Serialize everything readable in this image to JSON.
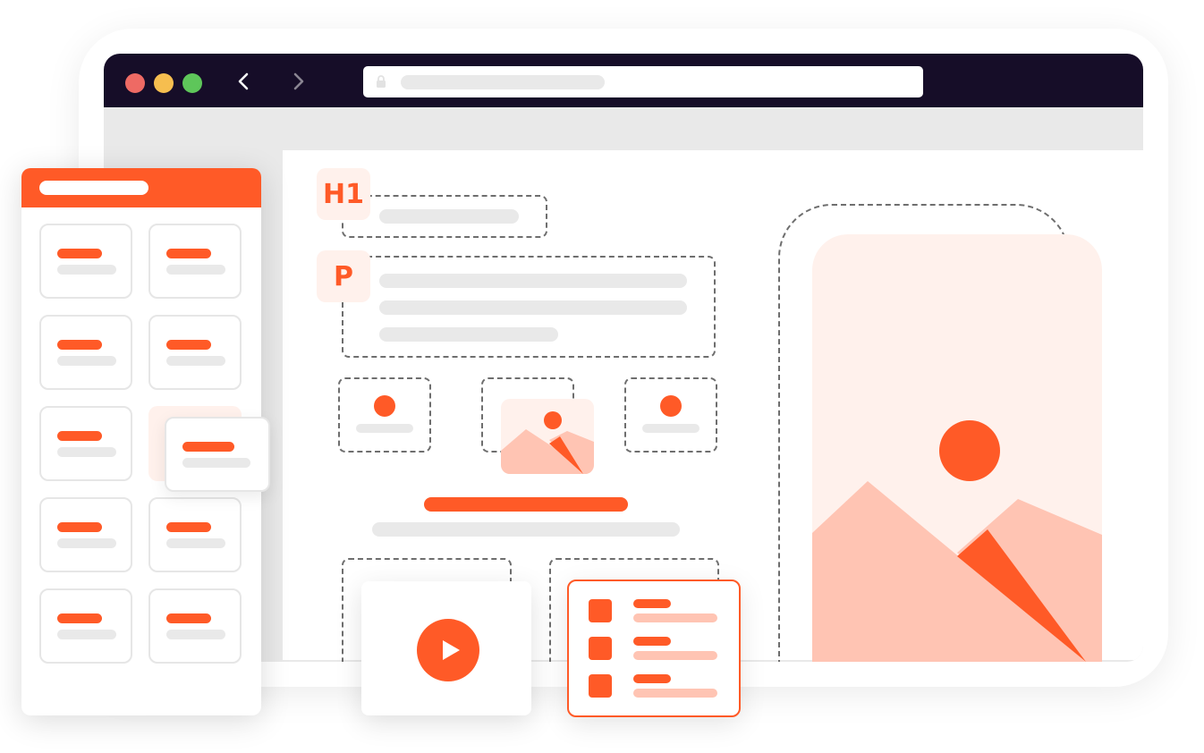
{
  "colors": {
    "accent": "#ff5a27",
    "accent_light": "#fff1ec",
    "accent_soft": "#ffc4b3",
    "titlebar": "#160d28",
    "placeholder_gray": "#e9e9e9",
    "traffic_red": "#ee6a64",
    "traffic_yellow": "#f6be4f",
    "traffic_green": "#5ec65a"
  },
  "browser": {
    "buttons": [
      "close",
      "minimize",
      "maximize"
    ],
    "icons": [
      "back-arrow-icon",
      "forward-arrow-icon",
      "lock-icon"
    ]
  },
  "editor": {
    "heading_tag": "H1",
    "paragraph_tag": "P"
  },
  "media": {
    "icons": [
      "play-icon",
      "image-icon",
      "avatar-icon"
    ]
  },
  "sidebar": {
    "tile_rows": 5,
    "tile_columns": 2
  },
  "list_card": {
    "items": 3
  }
}
